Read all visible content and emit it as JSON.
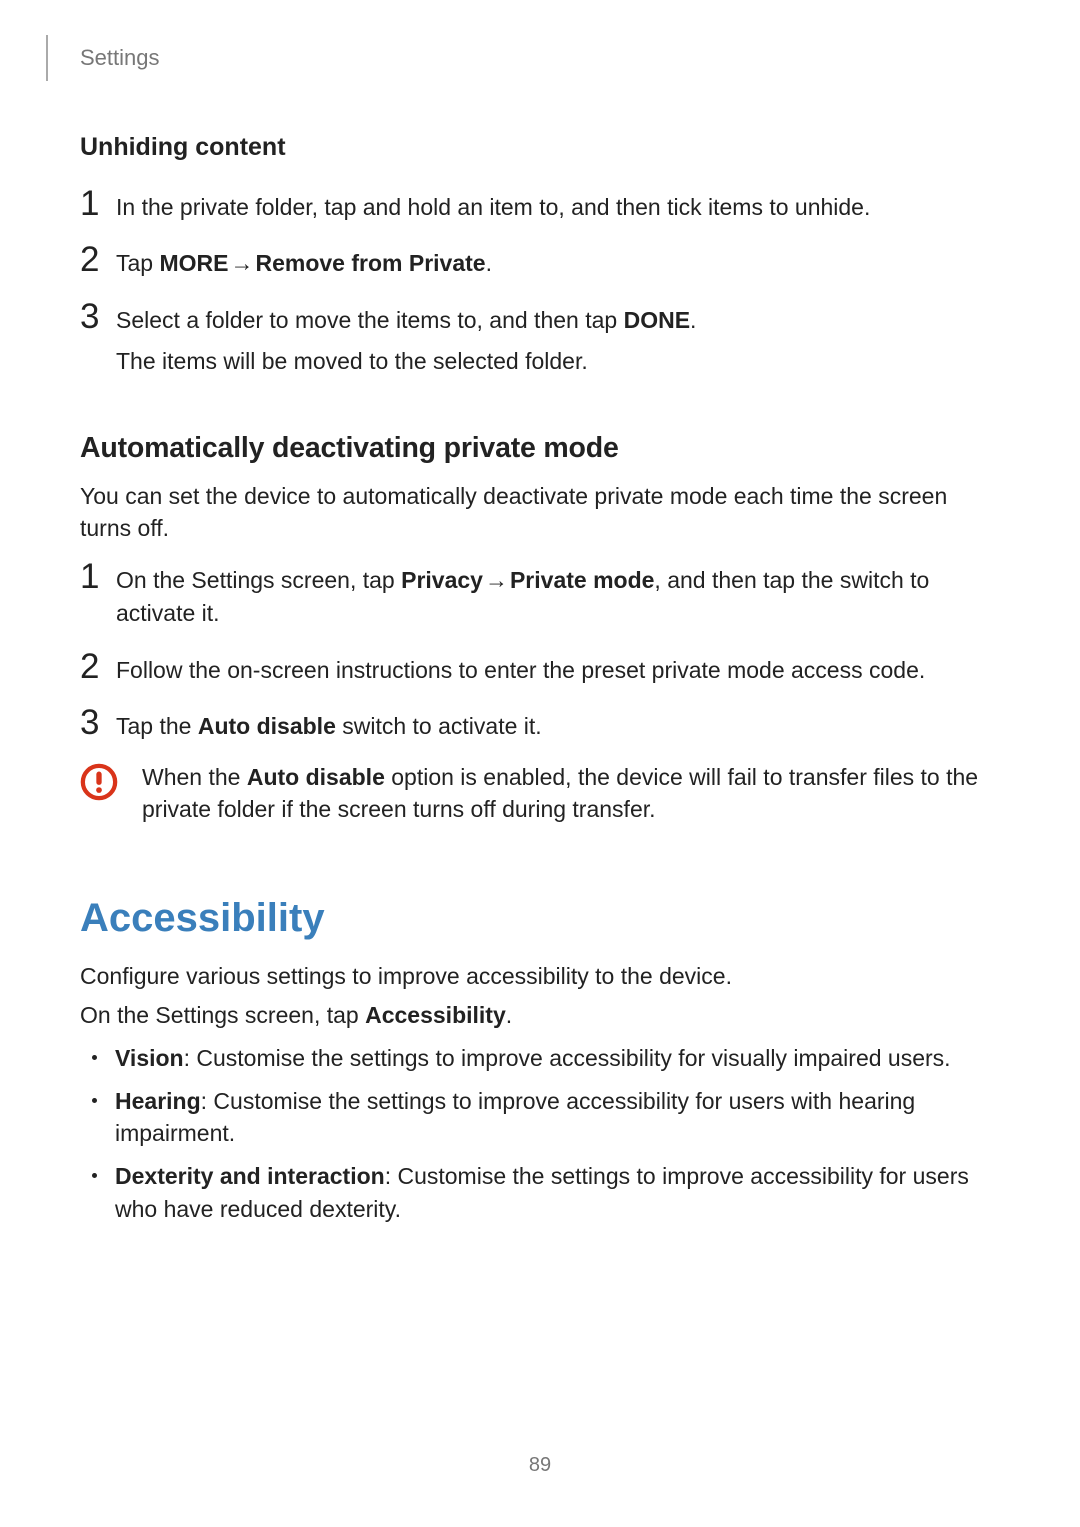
{
  "header": {
    "section": "Settings"
  },
  "unhiding": {
    "title": "Unhiding content",
    "steps": [
      {
        "n": "1",
        "text": "In the private folder, tap and hold an item to, and then tick items to unhide."
      },
      {
        "n": "2",
        "pre": "Tap ",
        "b1": "MORE",
        "arrow": " → ",
        "b2": "Remove from Private",
        "post": "."
      },
      {
        "n": "3",
        "line1_pre": "Select a folder to move the items to, and then tap ",
        "line1_b": "DONE",
        "line1_post": ".",
        "line2": "The items will be moved to the selected folder."
      }
    ]
  },
  "autodeact": {
    "title": "Automatically deactivating private mode",
    "intro": "You can set the device to automatically deactivate private mode each time the screen turns off.",
    "steps": [
      {
        "n": "1",
        "pre": "On the Settings screen, tap ",
        "b1": "Privacy",
        "arrow": " → ",
        "b2": "Private mode",
        "post": ", and then tap the switch to activate it."
      },
      {
        "n": "2",
        "text": "Follow the on-screen instructions to enter the preset private mode access code."
      },
      {
        "n": "3",
        "pre": "Tap the ",
        "b1": "Auto disable",
        "post": " switch to activate it."
      }
    ],
    "callout": {
      "pre": "When the ",
      "b": "Auto disable",
      "post": " option is enabled, the device will fail to transfer files to the private folder if the screen turns off during transfer."
    }
  },
  "accessibility": {
    "title": "Accessibility",
    "intro1": "Configure various settings to improve accessibility to the device.",
    "intro2_pre": "On the Settings screen, tap ",
    "intro2_b": "Accessibility",
    "intro2_post": ".",
    "bullets": [
      {
        "b": "Vision",
        "rest": ": Customise the settings to improve accessibility for visually impaired users."
      },
      {
        "b": "Hearing",
        "rest": ": Customise the settings to improve accessibility for users with hearing impairment."
      },
      {
        "b": "Dexterity and interaction",
        "rest": ": Customise the settings to improve accessibility for users who have reduced dexterity."
      }
    ]
  },
  "page_number": "89"
}
